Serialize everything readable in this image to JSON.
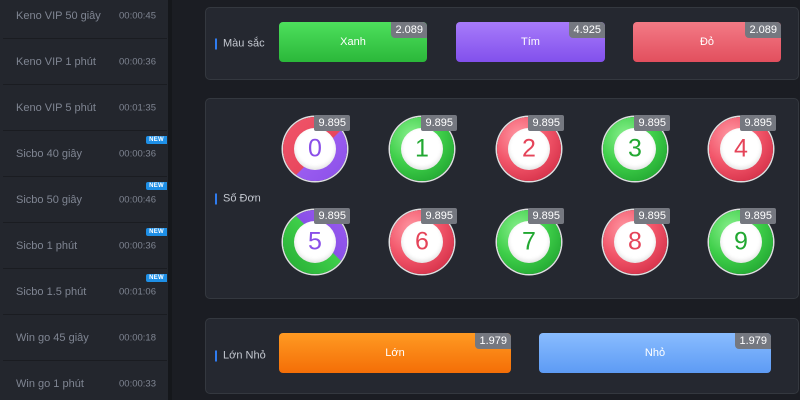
{
  "sidebar": {
    "items": [
      {
        "name": "Keno VIP 50 giây",
        "time": "00:00:45",
        "badge": ""
      },
      {
        "name": "Keno VIP 1 phút",
        "time": "00:00:36",
        "badge": ""
      },
      {
        "name": "Keno VIP 5 phút",
        "time": "00:01:35",
        "badge": ""
      },
      {
        "name": "Sicbo 40 giây",
        "time": "00:00:36",
        "badge": "NEW"
      },
      {
        "name": "Sicbo 50 giây",
        "time": "00:00:46",
        "badge": "NEW"
      },
      {
        "name": "Sicbo 1 phút",
        "time": "00:00:36",
        "badge": "NEW"
      },
      {
        "name": "Sicbo 1.5 phút",
        "time": "00:01:06",
        "badge": "NEW"
      },
      {
        "name": "Win go 45 giây",
        "time": "00:00:18",
        "badge": ""
      },
      {
        "name": "Win go 1 phút",
        "time": "00:00:33",
        "badge": ""
      }
    ]
  },
  "color_section": {
    "label": "Màu sắc",
    "buttons": [
      {
        "label": "Xanh",
        "odds": "2.089",
        "color": "#3ccd4a"
      },
      {
        "label": "Tím",
        "odds": "4.925",
        "color": "#9462f2"
      },
      {
        "label": "Đỏ",
        "odds": "2.089",
        "color": "#ec6270"
      }
    ]
  },
  "number_section": {
    "label": "Số Đơn",
    "balls": [
      {
        "number": "0",
        "odds": "9.895",
        "style": "red-violet"
      },
      {
        "number": "1",
        "odds": "9.895",
        "style": "green"
      },
      {
        "number": "2",
        "odds": "9.895",
        "style": "red"
      },
      {
        "number": "3",
        "odds": "9.895",
        "style": "green"
      },
      {
        "number": "4",
        "odds": "9.895",
        "style": "red"
      },
      {
        "number": "5",
        "odds": "9.895",
        "style": "green-violet"
      },
      {
        "number": "6",
        "odds": "9.895",
        "style": "red"
      },
      {
        "number": "7",
        "odds": "9.895",
        "style": "green"
      },
      {
        "number": "8",
        "odds": "9.895",
        "style": "red"
      },
      {
        "number": "9",
        "odds": "9.895",
        "style": "green"
      }
    ]
  },
  "size_section": {
    "label": "Lớn Nhỏ",
    "buttons": [
      {
        "label": "Lớn",
        "odds": "1.979",
        "color": "#f7820f"
      },
      {
        "label": "Nhỏ",
        "odds": "1.979",
        "color": "#74acfa"
      }
    ]
  }
}
